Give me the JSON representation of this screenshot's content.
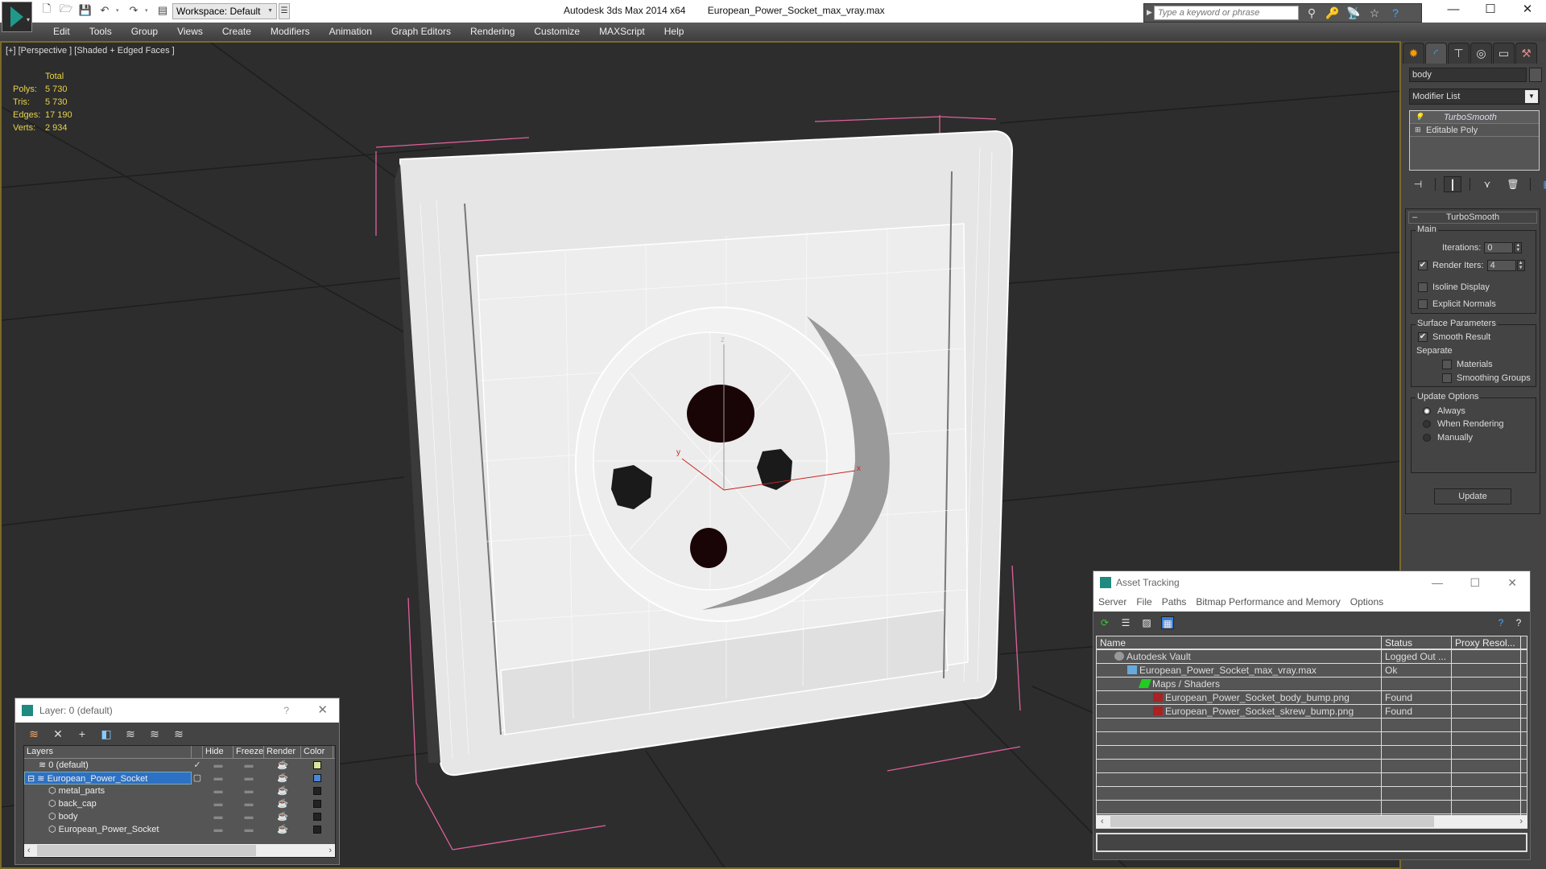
{
  "titlebar": {
    "app_name": "Autodesk 3ds Max  2014 x64",
    "file_name": "European_Power_Socket_max_vray.max",
    "workspace_label": "Workspace: Default",
    "search_placeholder": "Type a keyword or phrase",
    "window_controls": {
      "minimize": "—",
      "maximize": "☐",
      "close": "✕"
    }
  },
  "menubar": {
    "items": [
      "Edit",
      "Tools",
      "Group",
      "Views",
      "Create",
      "Modifiers",
      "Animation",
      "Graph Editors",
      "Rendering",
      "Customize",
      "MAXScript",
      "Help"
    ]
  },
  "viewport": {
    "label": "[+] [Perspective ] [Shaded + Edged Faces ]",
    "stats": {
      "header": "Total",
      "rows": [
        {
          "label": "Polys:",
          "value": "5 730"
        },
        {
          "label": "Tris:",
          "value": "5 730"
        },
        {
          "label": "Edges:",
          "value": "17 190"
        },
        {
          "label": "Verts:",
          "value": "2 934"
        }
      ]
    },
    "axes": {
      "x": "x",
      "y": "y",
      "z": "z"
    }
  },
  "command_panel": {
    "tabs": [
      "create",
      "modify",
      "hierarchy",
      "motion",
      "display",
      "utilities"
    ],
    "active_tab": "modify",
    "object_name": "body",
    "modifier_list_label": "Modifier List",
    "stack": [
      {
        "label": "TurboSmooth",
        "selected": true
      },
      {
        "label": "Editable Poly",
        "selected": false
      }
    ],
    "rollout": {
      "title": "TurboSmooth",
      "main_group": "Main",
      "iterations_label": "Iterations:",
      "iterations_value": "0",
      "render_iters_label": "Render Iters:",
      "render_iters_value": "4",
      "render_iters_checked": true,
      "isoline_label": "Isoline Display",
      "explicit_normals_label": "Explicit Normals",
      "surface_group": "Surface Parameters",
      "smooth_result_label": "Smooth Result",
      "separate_label": "Separate",
      "materials_label": "Materials",
      "smoothing_groups_label": "Smoothing Groups",
      "update_group": "Update Options",
      "update_options": [
        "Always",
        "When Rendering",
        "Manually"
      ],
      "update_selected": "Always",
      "update_button": "Update"
    }
  },
  "layer_dialog": {
    "title": "Layer: 0 (default)",
    "help": "?",
    "close": "✕",
    "columns": [
      "Layers",
      "Hide",
      "Freeze",
      "Render",
      "Color"
    ],
    "rows": [
      {
        "name": "0 (default)",
        "indent": 1,
        "current": true,
        "color": "#d9e59a",
        "selected": false
      },
      {
        "name": "European_Power_Socket",
        "indent": 0,
        "current": false,
        "color": "#4a86d8",
        "selected": true
      },
      {
        "name": "metal_parts",
        "indent": 2,
        "current": false,
        "color": "#222222",
        "selected": false
      },
      {
        "name": "back_cap",
        "indent": 2,
        "current": false,
        "color": "#222222",
        "selected": false
      },
      {
        "name": "body",
        "indent": 2,
        "current": false,
        "color": "#222222",
        "selected": false
      },
      {
        "name": "European_Power_Socket",
        "indent": 2,
        "current": false,
        "color": "#222222",
        "selected": false
      }
    ]
  },
  "asset_dialog": {
    "title": "Asset Tracking",
    "menu": [
      "Server",
      "File",
      "Paths",
      "Bitmap Performance and Memory",
      "Options"
    ],
    "columns": [
      "Name",
      "Status",
      "Proxy Resol..."
    ],
    "rows": [
      {
        "name": "Autodesk Vault",
        "status": "Logged Out ...",
        "icon": "vault-icon",
        "indent": 1
      },
      {
        "name": "European_Power_Socket_max_vray.max",
        "status": "Ok",
        "icon": "max-file-icon",
        "indent": 2
      },
      {
        "name": "Maps / Shaders",
        "status": "",
        "icon": "maps-icon",
        "indent": 3
      },
      {
        "name": "European_Power_Socket_body_bump.png",
        "status": "Found",
        "icon": "png-icon",
        "indent": 4
      },
      {
        "name": "European_Power_Socket_skrew_bump.png",
        "status": "Found",
        "icon": "png-icon",
        "indent": 4
      }
    ],
    "empty_rows": 8
  },
  "colors": {
    "viewport_border": "#7a6a2a",
    "stats_text": "#e8d24a",
    "selection_blue": "#2d71c4",
    "bbox_pink": "#e0609a"
  }
}
